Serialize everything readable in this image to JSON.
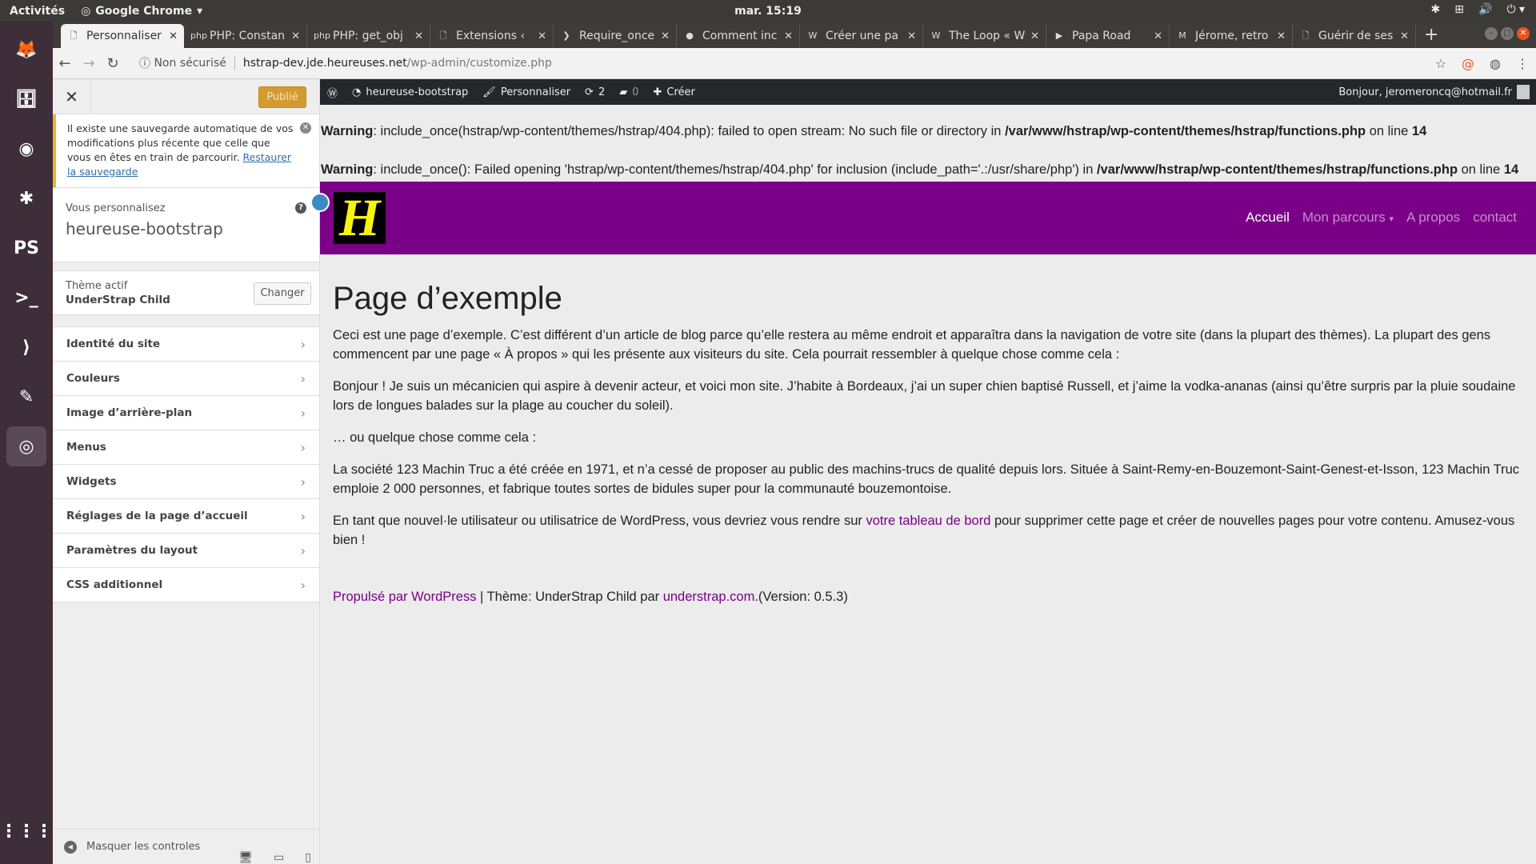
{
  "system": {
    "activities": "Activités",
    "app": "Google Chrome",
    "clock": "mar. 15:19"
  },
  "dock": [
    {
      "name": "firefox-icon",
      "g": "🦊"
    },
    {
      "name": "files-icon",
      "g": "🗄"
    },
    {
      "name": "discord-icon",
      "g": "◉"
    },
    {
      "name": "slack-icon",
      "g": "✱"
    },
    {
      "name": "phpstorm-icon",
      "g": "PS"
    },
    {
      "name": "terminal-icon",
      "g": ">_"
    },
    {
      "name": "vscode-icon",
      "g": "⟩"
    },
    {
      "name": "text-editor-icon",
      "g": "✎"
    },
    {
      "name": "chrome-icon",
      "g": "◎"
    }
  ],
  "dock_apps": "⋮⋮⋮",
  "tabs": [
    {
      "title": "Personnaliser",
      "icon": "🗋"
    },
    {
      "title": "PHP: Constan",
      "icon": "php"
    },
    {
      "title": "PHP: get_obj",
      "icon": "php"
    },
    {
      "title": "Extensions ‹",
      "icon": "🗋"
    },
    {
      "title": "Require_once",
      "icon": "❯"
    },
    {
      "title": "Comment inc",
      "icon": "●"
    },
    {
      "title": "Créer une pa",
      "icon": "W"
    },
    {
      "title": "The Loop « W",
      "icon": "W"
    },
    {
      "title": "Papa Road",
      "icon": "▶"
    },
    {
      "title": "Jérome, retro",
      "icon": "M"
    },
    {
      "title": "Guérir de ses",
      "icon": "🗋"
    }
  ],
  "toolbar": {
    "security": "Non sécurisé",
    "url_host": "hstrap-dev.jde.heureuses.net",
    "url_path": "/wp-admin/customize.php"
  },
  "adminbar": {
    "site": "heureuse-bootstrap",
    "customize": "Personnaliser",
    "updates": "2",
    "comments": "0",
    "new": "Créer",
    "greeting": "Bonjour, jeromeroncq@hotmail.fr"
  },
  "customizer": {
    "publish": "Publié",
    "notice_text": "Il existe une sauvegarde automatique de vos modifications plus récente que celle que vous en êtes en train de parcourir.",
    "notice_link": "Restaurer la sauvegarde",
    "customizing_label": "Vous personnalisez",
    "site_name": "heureuse-bootstrap",
    "theme_label": "Thème actif",
    "theme_name": "UnderStrap Child",
    "change": "Changer",
    "sections": [
      "Identité du site",
      "Couleurs",
      "Image d’arrière-plan",
      "Menus",
      "Widgets",
      "Réglages de la page d’accueil",
      "Paramètres du layout",
      "CSS additionnel"
    ],
    "hide_controls": "Masquer les controles"
  },
  "preview": {
    "warnings": [
      {
        "label": "Warning",
        "msg": ": include_once(hstrap/wp-content/themes/hstrap/404.php): failed to open stream: No such file or directory in ",
        "file": "/var/www/hstrap/wp-content/themes/hstrap/functions.php",
        "on": " on line ",
        "line": "14"
      },
      {
        "label": "Warning",
        "msg": ": include_once(): Failed opening 'hstrap/wp-content/themes/hstrap/404.php' for inclusion (include_path='.:/usr/share/php') in ",
        "file": "/var/www/hstrap/wp-content/themes/hstrap/functions.php",
        "on": " on line ",
        "line": "14"
      }
    ],
    "logo_letter": "H",
    "nav": [
      "Accueil",
      "Mon parcours",
      "A propos",
      "contact"
    ],
    "title": "Page d’exemple",
    "p1": "Ceci est une page d’exemple. C’est différent d’un article de blog parce qu’elle restera au même endroit et apparaîtra dans la navigation de votre site (dans la plupart des thèmes). La plupart des gens commencent par une page « À propos » qui les présente aux visiteurs du site. Cela pourrait ressembler à quelque chose comme cela :",
    "p2": "Bonjour ! Je suis un mécanicien qui aspire à devenir acteur, et voici mon site. J’habite à Bordeaux, j’ai un super chien baptisé Russell, et j’aime la vodka-ananas (ainsi qu’être surpris par la pluie soudaine lors de longues balades sur la plage au coucher du soleil).",
    "p3": "… ou quelque chose comme cela :",
    "p4": "La société 123 Machin Truc a été créée en 1971, et n’a cessé de proposer au public des machins-trucs de qualité depuis lors. Située à Saint-Remy-en-Bouzemont-Saint-Genest-et-Isson, 123 Machin Truc emploie 2 000 personnes, et fabrique toutes sortes de bidules super pour la communauté bouzemontoise.",
    "p5_a": "En tant que nouvel·le utilisateur ou utilisatrice de WordPress, vous devriez vous rendre sur ",
    "p5_link": "votre tableau de bord",
    "p5_b": " pour supprimer cette page et créer de nouvelles pages pour votre contenu. Amusez-vous bien !",
    "footer_link1": "Propulsé par WordPress",
    "footer_mid": " | Thème: UnderStrap Child par ",
    "footer_link2": "understrap.com",
    "footer_end": ".(Version: 0.5.3)"
  },
  "colors": {
    "header": "#7a0087",
    "logo_bg": "#000000",
    "logo_fg": "#f6f313",
    "publish": "#d39a30",
    "adminbar": "#23282d"
  }
}
